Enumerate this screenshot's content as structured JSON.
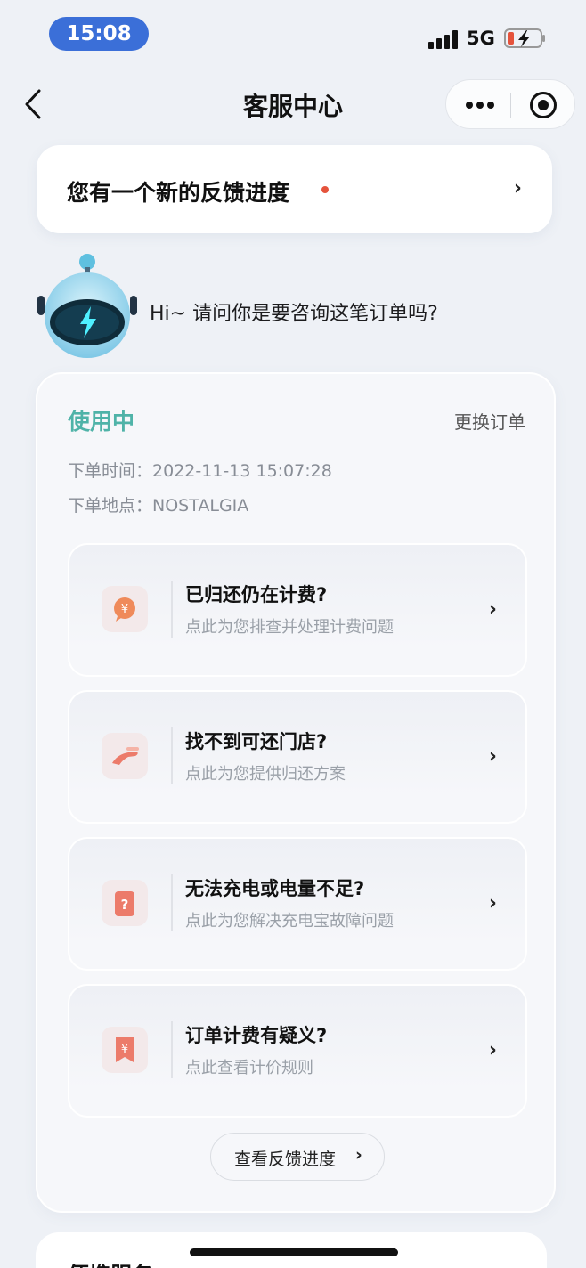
{
  "status_bar": {
    "time": "15:08",
    "network": "5G"
  },
  "nav": {
    "title": "客服中心"
  },
  "feedback_banner": {
    "text": "您有一个新的反馈进度"
  },
  "greeting": "Hi~ 请问你是要咨询这笔订单吗?",
  "order": {
    "status": "使用中",
    "change_label": "更换订单",
    "time_label": "下单时间：",
    "time_value": "2022-11-13 15:07:28",
    "place_label": "下单地点：",
    "place_value": "NOSTALGIA"
  },
  "issues": [
    {
      "title": "已归还仍在计费?",
      "subtitle": "点此为您排查并处理计费问题",
      "icon": "yen-bubble-icon"
    },
    {
      "title": "找不到可还门店?",
      "subtitle": "点此为您提供归还方案",
      "icon": "hand-icon"
    },
    {
      "title": "无法充电或电量不足?",
      "subtitle": "点此为您解决充电宝故障问题",
      "icon": "question-icon"
    },
    {
      "title": "订单计费有疑义?",
      "subtitle": "点此查看计价规则",
      "icon": "yen-ribbon-icon"
    }
  ],
  "progress_button": "查看反馈进度",
  "bottom_card": {
    "title": "便携服务"
  },
  "colors": {
    "accent_teal": "#4fb3a8",
    "red_dot": "#e5533c",
    "time_pill": "#3b6fd8",
    "icon_coral": "#ec7b6a"
  }
}
